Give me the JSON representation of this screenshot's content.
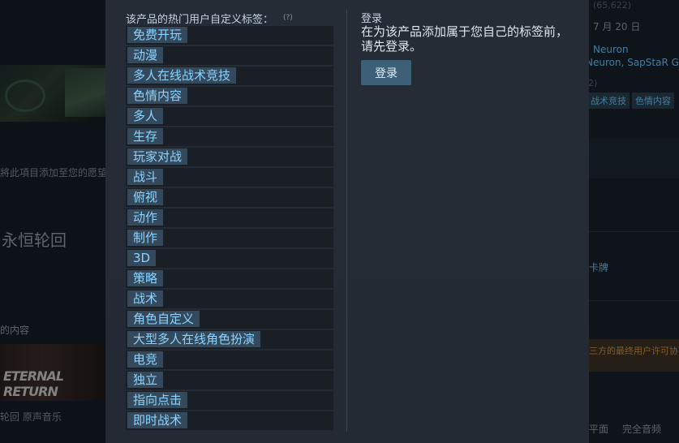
{
  "background": {
    "wishlist_text": "將此項目添加至您的愿望",
    "game_title": "永恒轮回",
    "content_heading": "的内容",
    "banner_logo": "ETERNAL RETURN",
    "music_text": "轮回 原声音乐",
    "right_review_count": "(65,622)",
    "right_date": "7 月 20 日",
    "right_developer": "Neuron",
    "right_publisher": "Neuron, SapStaR Gam",
    "right_count2": "2)",
    "right_tag_1": "战术竞技",
    "right_tag_2": "色情内容",
    "right_card": "卡牌",
    "right_eula": "三方的最终用户许可协",
    "right_footer_1": "平面",
    "right_footer_2": "完全音频"
  },
  "modal": {
    "tags_heading": "该产品的热门用户自定义标签：",
    "help_mark": "(?)",
    "tags": [
      {
        "label": "免费开玩"
      },
      {
        "label": "动漫"
      },
      {
        "label": "多人在线战术竞技"
      },
      {
        "label": "色情内容"
      },
      {
        "label": "多人"
      },
      {
        "label": "生存"
      },
      {
        "label": "玩家对战"
      },
      {
        "label": "战斗"
      },
      {
        "label": "俯视"
      },
      {
        "label": "动作"
      },
      {
        "label": "制作"
      },
      {
        "label": "3D"
      },
      {
        "label": "策略"
      },
      {
        "label": "战术"
      },
      {
        "label": "角色自定义"
      },
      {
        "label": "大型多人在线角色扮演"
      },
      {
        "label": "电竞"
      },
      {
        "label": "独立"
      },
      {
        "label": "指向点击"
      },
      {
        "label": "即时战术"
      }
    ],
    "login_title": "登录",
    "login_desc": "在为该产品添加属于您自己的标签前，请先登录。",
    "login_button": "登录"
  }
}
